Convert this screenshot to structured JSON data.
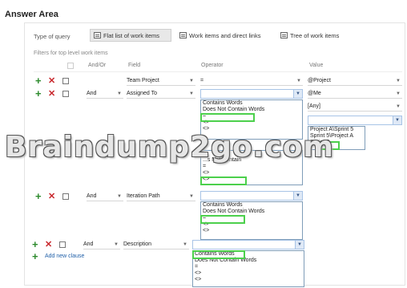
{
  "header": {
    "title": "Answer Area"
  },
  "query_type": {
    "label": "Type of query",
    "options": [
      "Flat list of work items",
      "Work items and direct links",
      "Tree of work items"
    ],
    "selected": "Flat list of work items"
  },
  "filters_label": "Filters for top level work items",
  "columns": {
    "andor": "And/Or",
    "field": "Field",
    "operator": "Operator",
    "value": "Value"
  },
  "rows": [
    {
      "andor": "",
      "field": "Team Project",
      "operator": "=",
      "value": "@Project"
    },
    {
      "andor": "And",
      "field": "Assigned To",
      "operator": "",
      "value": "@Me"
    },
    {
      "andor": "",
      "field": "",
      "operator": "",
      "value": "[Any]"
    },
    {
      "andor": "And",
      "field": "Iteration Path",
      "operator": ""
    },
    {
      "andor": "And",
      "field": "Description",
      "operator": ""
    }
  ],
  "operator_lists": {
    "list1": [
      "Contains Words",
      "Does Not Contain Words",
      "=",
      "<>",
      "<>"
    ],
    "list2": [
      "...s Not Contain",
      "=",
      "<>",
      "<>"
    ],
    "list3": [
      "Contains Words",
      "Does Not Contain Words",
      "=",
      "<>",
      "<>"
    ],
    "list4": [
      "Contains Words",
      "Does Not Contain Words",
      "=",
      "<>",
      "<>"
    ]
  },
  "value_list": [
    "Project A\\Sprint 5",
    "Sprint 5\\Project A",
    "Sprint 5"
  ],
  "watermark": "Braindump2go.com",
  "add_clause": "Add new clause",
  "colors": {
    "accent_green": "#4cd04c",
    "plus": "#2e8b2e",
    "delete": "#c8262b",
    "link": "#1f5fa8"
  }
}
